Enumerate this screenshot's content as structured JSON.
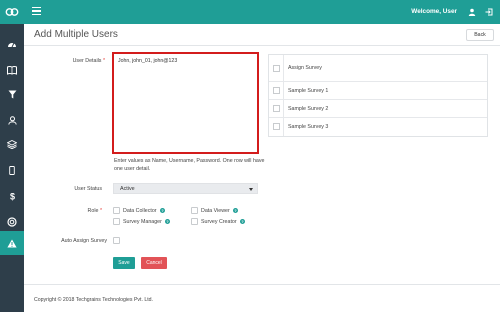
{
  "topbar": {
    "welcome": "Welcome, User",
    "brand_color": "#1f9e96",
    "logo_icon": "logo-icon",
    "menu_icon": "hamburger-icon",
    "user_icon": "user-icon",
    "logout_icon": "logout-icon"
  },
  "sidebar": {
    "items": [
      {
        "icon": "dashboard-icon"
      },
      {
        "icon": "book-icon"
      },
      {
        "icon": "filter-icon"
      },
      {
        "icon": "user-icon"
      },
      {
        "icon": "layers-icon"
      },
      {
        "icon": "mobile-icon"
      },
      {
        "icon": "dollar-icon"
      },
      {
        "icon": "lifebuoy-icon"
      },
      {
        "icon": "warning-icon",
        "active": true
      }
    ]
  },
  "header": {
    "title": "Add Multiple Users",
    "back_label": "Back"
  },
  "form": {
    "user_details_label": "User Details",
    "required_mark": "*",
    "user_details_value": "John, john_01, john@123",
    "help_text": "Enter values as Name, Username, Password. One row will have one user detail.",
    "user_status_label": "User Status",
    "user_status_value": "Active",
    "role_label": "Role",
    "roles": {
      "data_collector": "Data Collector",
      "data_viewer": "Data Viewer",
      "survey_manager": "Survey Manager",
      "survey_creator": "Survey Creator"
    },
    "auto_assign_label": "Auto Assign Survey",
    "save_label": "Save",
    "cancel_label": "Cancel"
  },
  "surveys": {
    "header": "Assign Survey",
    "items": [
      "Sample Survey 1",
      "Sample Survey 2",
      "Sample Survey 3"
    ]
  },
  "footer": {
    "copyright": "Copyright © 2018 Techgrains Technologies Pvt. Ltd."
  }
}
